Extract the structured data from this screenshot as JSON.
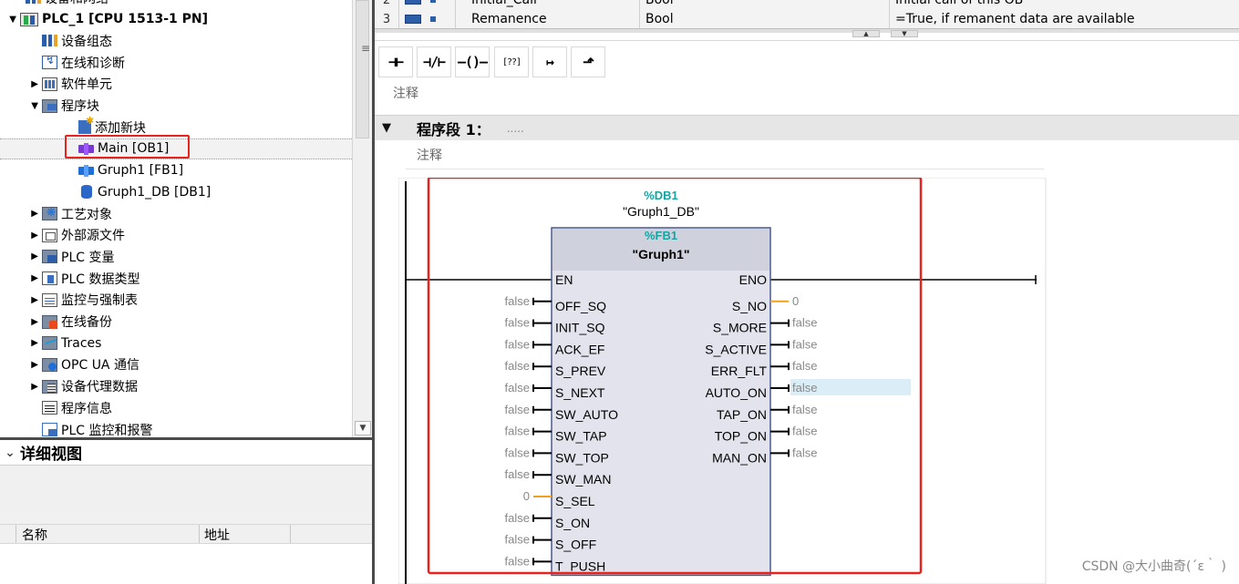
{
  "project_tree": {
    "items": [
      {
        "label": "设备和网络",
        "indent": 0,
        "toggle": "",
        "icon": "network-icon"
      },
      {
        "label": "PLC_1 [CPU 1513-1 PN]",
        "indent": 1,
        "toggle": "▼",
        "icon": "plc-icon",
        "bold": true
      },
      {
        "label": "设备组态",
        "indent": 2,
        "toggle": "",
        "icon": "device-config-icon"
      },
      {
        "label": "在线和诊断",
        "indent": 2,
        "toggle": "",
        "icon": "diagnostics-icon"
      },
      {
        "label": "软件单元",
        "indent": 2,
        "toggle": "▶",
        "icon": "software-units-icon"
      },
      {
        "label": "程序块",
        "indent": 2,
        "toggle": "▼",
        "icon": "program-blocks-icon"
      },
      {
        "label": "添加新块",
        "indent": 3,
        "toggle": "",
        "icon": "add-block-icon"
      },
      {
        "label": "Main [OB1]",
        "indent": 3,
        "toggle": "",
        "icon": "ob-icon",
        "selected": true
      },
      {
        "label": "Gruph1 [FB1]",
        "indent": 3,
        "toggle": "",
        "icon": "fb-icon"
      },
      {
        "label": "Gruph1_DB [DB1]",
        "indent": 3,
        "toggle": "",
        "icon": "db-icon"
      },
      {
        "label": "工艺对象",
        "indent": 2,
        "toggle": "▶",
        "icon": "technology-objects-icon"
      },
      {
        "label": "外部源文件",
        "indent": 2,
        "toggle": "▶",
        "icon": "external-source-icon"
      },
      {
        "label": "PLC 变量",
        "indent": 2,
        "toggle": "▶",
        "icon": "plc-tags-icon"
      },
      {
        "label": "PLC 数据类型",
        "indent": 2,
        "toggle": "▶",
        "icon": "plc-data-types-icon"
      },
      {
        "label": "监控与强制表",
        "indent": 2,
        "toggle": "▶",
        "icon": "watch-force-tables-icon"
      },
      {
        "label": "在线备份",
        "indent": 2,
        "toggle": "▶",
        "icon": "online-backup-icon"
      },
      {
        "label": "Traces",
        "indent": 2,
        "toggle": "▶",
        "icon": "traces-icon"
      },
      {
        "label": "OPC UA 通信",
        "indent": 2,
        "toggle": "▶",
        "icon": "opc-ua-icon"
      },
      {
        "label": "设备代理数据",
        "indent": 2,
        "toggle": "▶",
        "icon": "device-proxy-icon"
      },
      {
        "label": "程序信息",
        "indent": 2,
        "toggle": "",
        "icon": "program-info-icon"
      },
      {
        "label": "PLC 监控和报警",
        "indent": 2,
        "toggle": "",
        "icon": "plc-alarms-icon"
      }
    ]
  },
  "detail_view": {
    "title": "详细视图",
    "col_name": "名称",
    "col_address": "地址"
  },
  "interface_table": {
    "rows": [
      {
        "num": "2",
        "name": "Initial_Call",
        "type": "Bool",
        "comment": "Initial call of this OB"
      },
      {
        "num": "3",
        "name": "Remanence",
        "type": "Bool",
        "comment": "=True, if remanent data are available"
      }
    ]
  },
  "toolbar": {
    "buttons": [
      {
        "name": "no-contact-button",
        "glyph": "⊣⊢"
      },
      {
        "name": "nc-contact-button",
        "glyph": "⊣/⊢"
      },
      {
        "name": "coil-button",
        "glyph": "–()–"
      },
      {
        "name": "empty-box-button",
        "glyph": "[??]"
      },
      {
        "name": "open-branch-button",
        "glyph": "↦"
      },
      {
        "name": "close-branch-button",
        "glyph": "⬏"
      }
    ]
  },
  "block_comment": "注释",
  "network": {
    "title": "程序段 1：",
    "title_dots": ".....",
    "comment": "注释"
  },
  "fb_instance": {
    "db_address": "%DB1",
    "db_name": "\"Gruph1_DB\"",
    "fb_address": "%FB1",
    "fb_name": "\"Gruph1\"",
    "inputs": [
      {
        "pin": "EN",
        "value": ""
      },
      {
        "pin": "OFF_SQ",
        "value": "false"
      },
      {
        "pin": "INIT_SQ",
        "value": "false"
      },
      {
        "pin": "ACK_EF",
        "value": "false"
      },
      {
        "pin": "S_PREV",
        "value": "false"
      },
      {
        "pin": "S_NEXT",
        "value": "false"
      },
      {
        "pin": "SW_AUTO",
        "value": "false"
      },
      {
        "pin": "SW_TAP",
        "value": "false"
      },
      {
        "pin": "SW_TOP",
        "value": "false"
      },
      {
        "pin": "SW_MAN",
        "value": "false"
      },
      {
        "pin": "S_SEL",
        "value": "0"
      },
      {
        "pin": "S_ON",
        "value": "false"
      },
      {
        "pin": "S_OFF",
        "value": "false"
      },
      {
        "pin": "T_PUSH",
        "value": "false"
      }
    ],
    "outputs": [
      {
        "pin": "ENO",
        "value": ""
      },
      {
        "pin": "S_NO",
        "value": "0"
      },
      {
        "pin": "S_MORE",
        "value": "false"
      },
      {
        "pin": "S_ACTIVE",
        "value": "false"
      },
      {
        "pin": "ERR_FLT",
        "value": "false"
      },
      {
        "pin": "AUTO_ON",
        "value": "false"
      },
      {
        "pin": "TAP_ON",
        "value": "false"
      },
      {
        "pin": "TOP_ON",
        "value": "false"
      },
      {
        "pin": "MAN_ON",
        "value": "false"
      }
    ]
  },
  "colors": {
    "highlight_red": "#e8231e",
    "address_teal": "#16a3a3",
    "int_pin_orange": "#f0a21e",
    "block_fill": "#e2e3ec",
    "block_border": "#4a5a8c",
    "selected_output_bg": "#dbeef8"
  },
  "watermark": "CSDN @大小曲奇(´ε｀ )"
}
